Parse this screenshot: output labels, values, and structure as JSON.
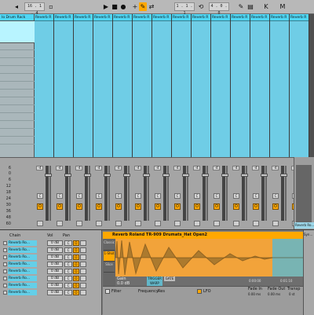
{
  "transport": {
    "position": "16 . 1 . 4",
    "loop_start": "1 . 1 . 1",
    "loop_length": "4 . 0 . 0"
  },
  "drum_rack": {
    "name": "Io Drum Rack"
  },
  "tracks": [
    {
      "name": "Reverb R"
    },
    {
      "name": "Reverb R"
    },
    {
      "name": "Reverb R"
    },
    {
      "name": "Reverb R"
    },
    {
      "name": "Reverb R"
    },
    {
      "name": "Reverb R"
    },
    {
      "name": "Reverb R"
    },
    {
      "name": "Reverb R"
    },
    {
      "name": "Reverb R"
    },
    {
      "name": "Reverb R"
    },
    {
      "name": "Reverb R"
    },
    {
      "name": "Reverb R"
    },
    {
      "name": "Reverb R"
    },
    {
      "name": "Reverb R"
    }
  ],
  "mixer": {
    "db_scale": [
      "6",
      "0",
      "6",
      "12",
      "18",
      "24",
      "30",
      "36",
      "48",
      "60"
    ],
    "strip_volume": "-4",
    "c_label": "C",
    "o_label": "O",
    "master_name": "Reverb Ro..."
  },
  "chain_list": {
    "head_chain": "Chain",
    "head_vol": "Vol",
    "head_pan": "Pan",
    "rows": [
      {
        "name": "Reverb Ro...",
        "vol": "0 dB",
        "pan": "C"
      },
      {
        "name": "Reverb Ro...",
        "vol": "0 dB",
        "pan": "C"
      },
      {
        "name": "Reverb Ro...",
        "vol": "0 dB",
        "pan": "C"
      },
      {
        "name": "Reverb Ro...",
        "vol": "0 dB",
        "pan": "C"
      },
      {
        "name": "Reverb Ro...",
        "vol": "0 dB",
        "pan": "C"
      },
      {
        "name": "Reverb Ro...",
        "vol": "0 dB",
        "pan": "C"
      },
      {
        "name": "Reverb Ro...",
        "vol": "0 dB",
        "pan": "C"
      },
      {
        "name": "Reverb Ro...",
        "vol": "0 dB",
        "pan": "C"
      }
    ]
  },
  "sampler": {
    "title": "Reverb Roland TR-909 Drumats_Hat Open2",
    "side_tabs": [
      "Classic",
      "1-Shot",
      "Slice"
    ],
    "gain_label": "Gain",
    "gain_value": "0.0 dB",
    "trigger_label": "TRIGGER",
    "gate_label": "GATE",
    "warp_label": "WARP",
    "filter_label": "Filter",
    "frequency_label": "Frequency",
    "res_label": "Res",
    "lfo_label": "LFO",
    "fade_in_label": "Fade In",
    "fade_out_label": "Fade Out",
    "transp_label": "Transp",
    "fade_in_value": "0.00 ms",
    "fade_out_value": "0.00 ms",
    "transp_value": "0 st",
    "time_label": "0:00:00",
    "end_label": "0:01:10",
    "synth_label": "Syn..."
  },
  "colors": {
    "clip_cyan": "#4fd6f4",
    "accent_orange": "#ffa800",
    "waveform_orange": "#f2a33a"
  }
}
